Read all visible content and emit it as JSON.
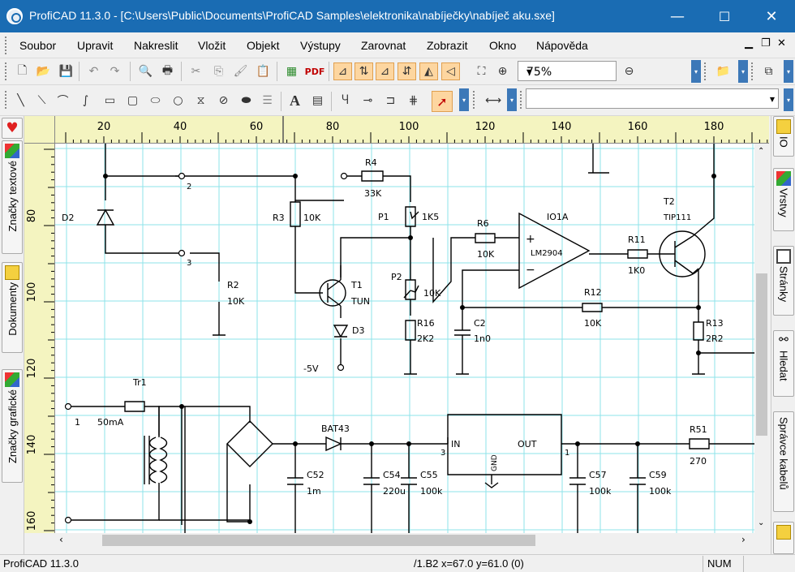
{
  "window": {
    "title": "ProfiCAD 11.3.0 - [C:\\Users\\Public\\Documents\\ProfiCAD Samples\\elektronika\\nabíječky\\nabíječ aku.sxe]",
    "minimize": "—",
    "maximize": "☐",
    "close": "✕"
  },
  "menu": [
    "Soubor",
    "Upravit",
    "Nakreslit",
    "Vložit",
    "Objekt",
    "Výstupy",
    "Zarovnat",
    "Zobrazit",
    "Okno",
    "Nápověda"
  ],
  "toolbar": {
    "zoom_value": "75%",
    "pdf_label": "PDF",
    "text_tool": "A"
  },
  "left_tabs": [
    "Značky textové",
    "Dokumenty",
    "Značky grafické"
  ],
  "right_tabs": [
    "IO",
    "Vrstvy",
    "Stránky",
    "Hledat",
    "Správce kabelů"
  ],
  "ruler": {
    "h": [
      "20",
      "40",
      "60",
      "80",
      "100",
      "120",
      "140",
      "160",
      "180"
    ],
    "v": [
      "80",
      "100",
      "120",
      "140",
      "160"
    ]
  },
  "schematic": {
    "labels": {
      "d2": "D2",
      "r3": "R3",
      "r3v": "10K",
      "r4": "R4",
      "r4v": "33K",
      "p1": "P1",
      "p1v": "1K5",
      "r6": "R6",
      "r6v": "10K",
      "io1a": "IO1A",
      "lm": "LM2904",
      "r11": "R11",
      "r11v": "1K0",
      "t2": "T2",
      "tip": "TIP111",
      "r2": "R2",
      "r2v": "10K",
      "t1": "T1",
      "tun": "TUN",
      "d3": "D3",
      "p2": "P2",
      "p2v": "10K",
      "r16": "R16",
      "r16v": "2K2",
      "c2": "C2",
      "c2v": "1n0",
      "r12": "R12",
      "r12v": "10K",
      "r13": "R13",
      "r13v": "2R2",
      "m5v": "-5V",
      "n2": "2",
      "n3": "3",
      "tr1": "Tr1",
      "n1": "1",
      "fuse": "50mA",
      "bat43": "BAT43",
      "in": "IN",
      "out": "OUT",
      "gnd": "GND",
      "pin3": "3",
      "pin1": "1",
      "r51": "R51",
      "r51v": "270",
      "c52": "C52",
      "c52v": "1m",
      "c54": "C54",
      "c54v": "220u",
      "c55": "C55",
      "c55v": "100k",
      "c57": "C57",
      "c57v": "100k",
      "c59": "C59",
      "c59v": "100k"
    }
  },
  "status": {
    "app": "ProfiCAD 11.3.0",
    "coords": "/1.B2  x=67.0  y=61.0 (0)",
    "num": "NUM"
  }
}
